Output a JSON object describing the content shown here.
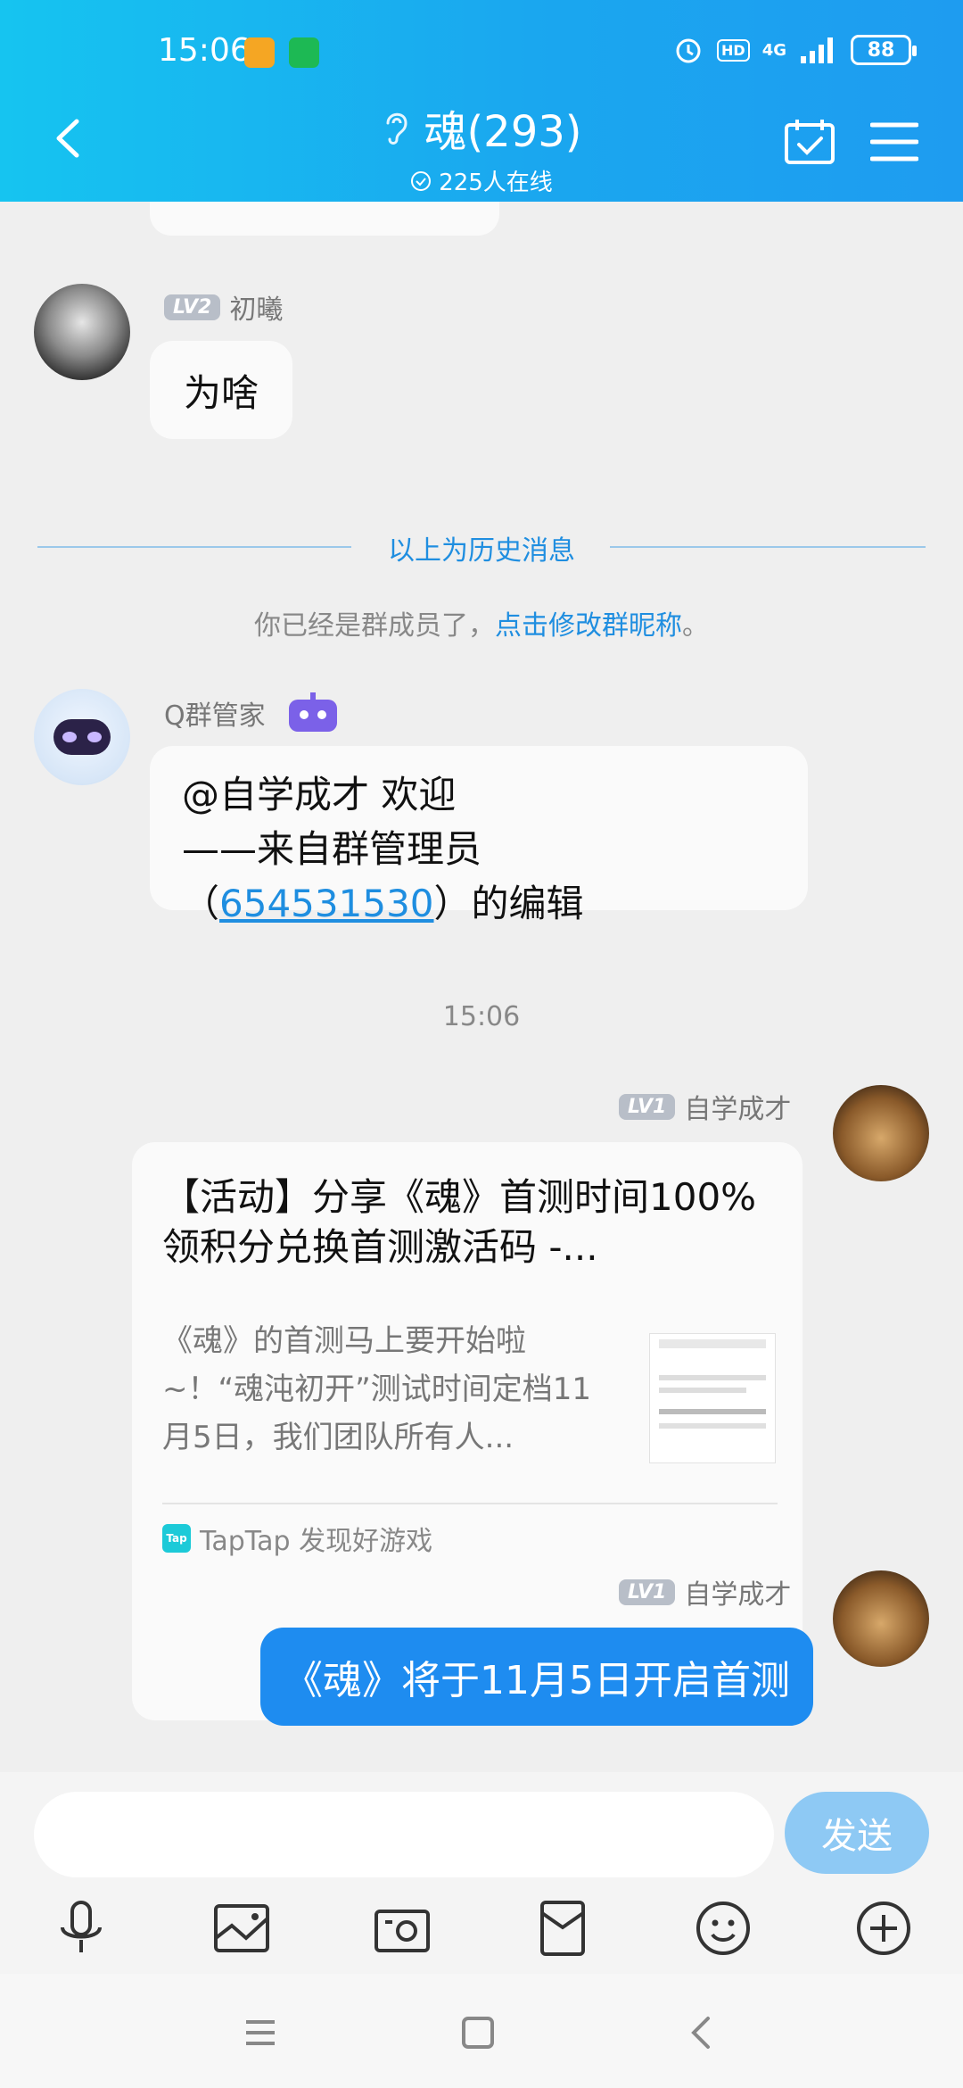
{
  "status_bar": {
    "time": "15:06",
    "network": "4G",
    "hd": "HD",
    "battery": "88"
  },
  "header": {
    "title": "魂(293)",
    "online": "225人在线"
  },
  "messages": {
    "m1": {
      "level": "LV2",
      "sender": "初曦",
      "text": "为啥"
    },
    "divider": "以上为历史消息",
    "notice_prefix": "你已经是群成员了，",
    "notice_link": "点击修改群昵称",
    "notice_suffix": "。",
    "bot": {
      "sender": "Q群管家",
      "line1": "@自学成才 欢迎",
      "line2": "——来自群管理员",
      "line3_prefix": "（",
      "line3_link": "654531530",
      "line3_suffix": "）的编辑"
    },
    "timestamp": "15:06",
    "card": {
      "level": "LV1",
      "sender": "自学成才",
      "title": "【活动】分享《魂》首测时间100%领积分兑换首测激活码 -...",
      "desc": "《魂》的首测马上要开始啦~！“魂沌初开”测试时间定档11月5日，我们团队所有人...",
      "source": "TapTap 发现好游戏",
      "source_logo": "Tap"
    },
    "m_last": {
      "level": "LV1",
      "sender": "自学成才",
      "text": "《魂》将于11月5日开启首测"
    }
  },
  "input": {
    "placeholder": "",
    "send_label": "发送"
  },
  "colors": {
    "header_start": "#16c4f0",
    "header_end": "#1e9cf0",
    "accent": "#1f8ee0",
    "bubble_self": "#1e8cf0"
  }
}
